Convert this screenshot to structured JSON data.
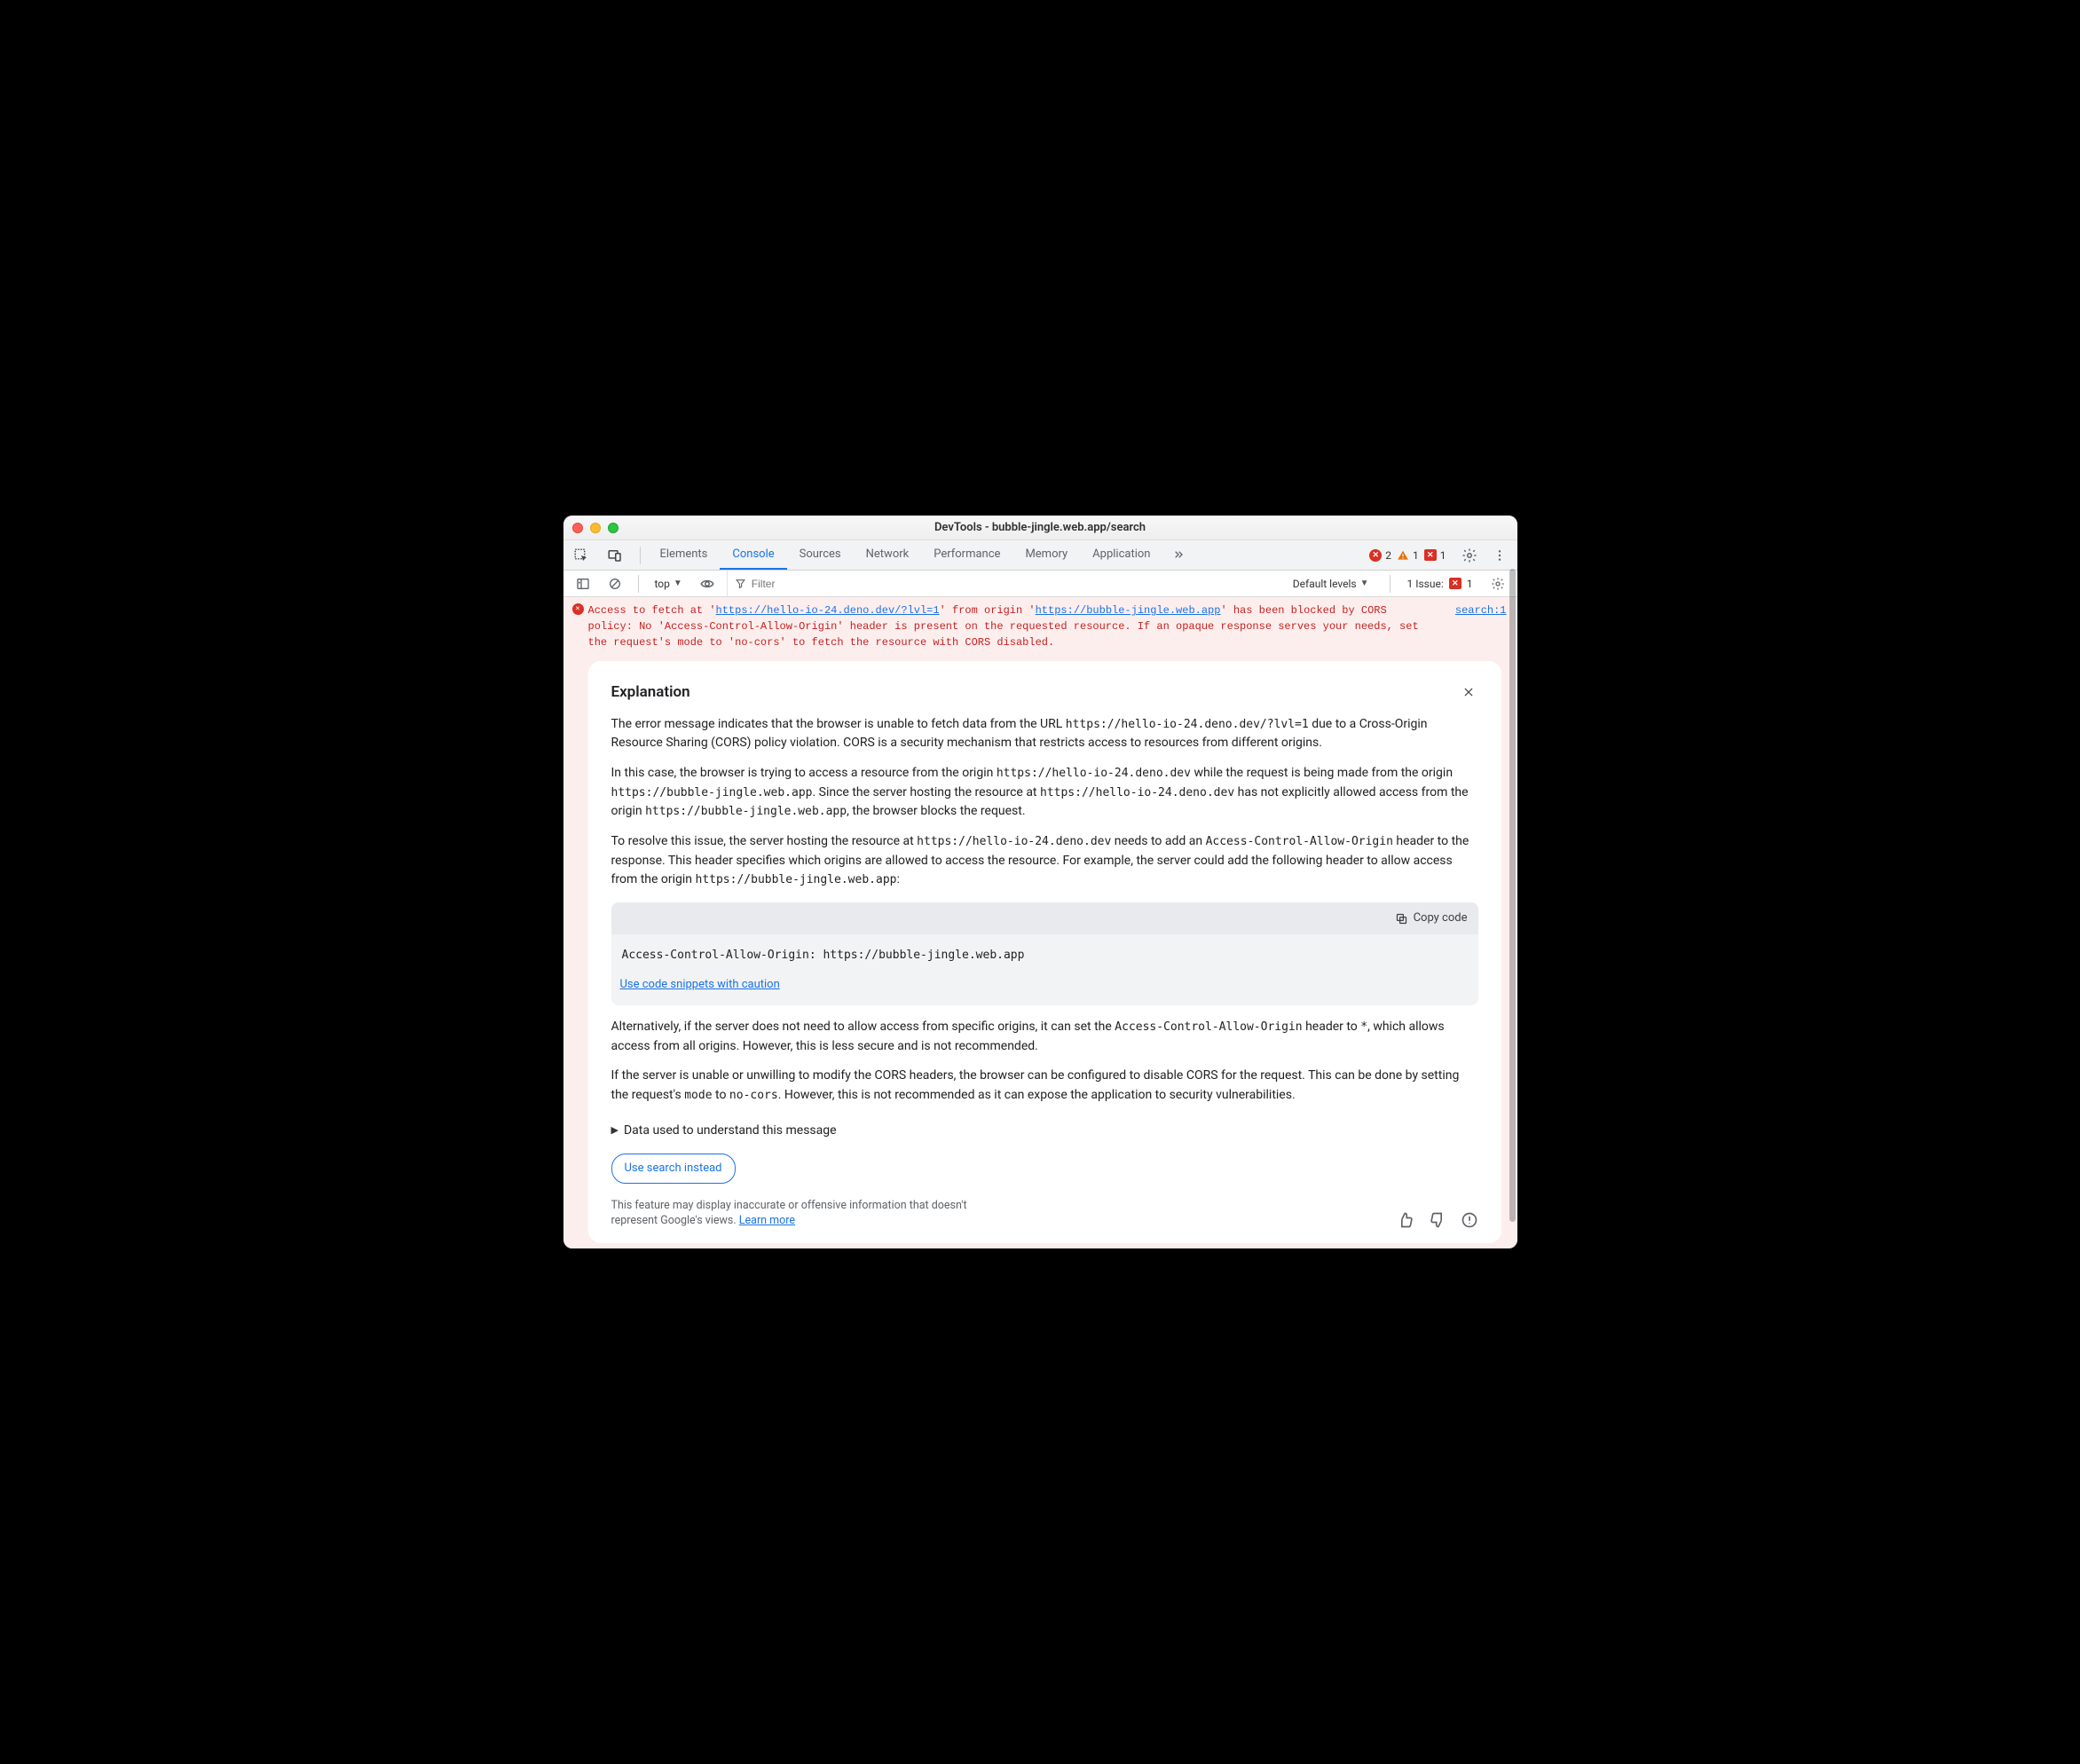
{
  "window_title": "DevTools - bubble-jingle.web.app/search",
  "tabs": [
    {
      "label": "Elements"
    },
    {
      "label": "Console"
    },
    {
      "label": "Sources"
    },
    {
      "label": "Network"
    },
    {
      "label": "Performance"
    },
    {
      "label": "Memory"
    },
    {
      "label": "Application"
    }
  ],
  "active_tab_index": 1,
  "status": {
    "errors": "2",
    "warnings": "1",
    "blocked": "1"
  },
  "toolbar": {
    "context_label": "top",
    "filter_placeholder": "Filter",
    "levels_label": "Default levels",
    "issues_label": "1 Issue:",
    "issues_count": "1"
  },
  "error": {
    "pre1": "Access to fetch at '",
    "url1": "https://hello-io-24.deno.dev/?lvl=1",
    "mid1": "' from origin '",
    "url2": "https://bubble-jingle.web.app",
    "post1": "' has been blocked by CORS policy: No 'Access-Control-Allow-Origin' header is present on the requested resource. If an opaque response serves your needs, set the request's mode to 'no-cors' to fetch the resource with CORS disabled.",
    "source": "search:1"
  },
  "card": {
    "title": "Explanation",
    "p1a": "The error message indicates that the browser is unable to fetch data from the URL ",
    "code1": "https://hello-io-24.deno.dev/?lvl=1",
    "p1b": " due to a Cross-Origin Resource Sharing (CORS) policy violation. CORS is a security mechanism that restricts access to resources from different origins.",
    "p2a": "In this case, the browser is trying to access a resource from the origin ",
    "code2": "https://hello-io-24.deno.dev",
    "p2b": " while the request is being made from the origin ",
    "code3": "https://bubble-jingle.web.app",
    "p2c": ". Since the server hosting the resource at ",
    "code4": "https://hello-io-24.deno.dev",
    "p2d": " has not explicitly allowed access from the origin ",
    "code5": "https://bubble-jingle.web.app",
    "p2e": ", the browser blocks the request.",
    "p3a": "To resolve this issue, the server hosting the resource at ",
    "code6": "https://hello-io-24.deno.dev",
    "p3b": " needs to add an ",
    "code7": "Access-Control-Allow-Origin",
    "p3c": " header to the response. This header specifies which origins are allowed to access the resource. For example, the server could add the following header to allow access from the origin ",
    "code8": "https://bubble-jingle.web.app",
    "p3d": ":",
    "copy_label": "Copy code",
    "code_block": "Access-Control-Allow-Origin: https://bubble-jingle.web.app",
    "caution_link": "Use code snippets with caution",
    "p4a": "Alternatively, if the server does not need to allow access from specific origins, it can set the ",
    "code9": "Access-Control-Allow-Origin",
    "p4b": " header to ",
    "code10": "*",
    "p4c": ", which allows access from all origins. However, this is less secure and is not recommended.",
    "p5a": "If the server is unable or unwilling to modify the CORS headers, the browser can be configured to disable CORS for the request. This can be done by setting the request's ",
    "code11": "mode",
    "p5b": " to ",
    "code12": "no-cors",
    "p5c": ". However, this is not recommended as it can expose the application to security vulnerabilities.",
    "details_label": "Data used to understand this message",
    "search_instead": "Use search instead",
    "disclaimer_text": "This feature may display inaccurate or offensive information that doesn't represent Google's views. ",
    "learn_more": "Learn more"
  }
}
